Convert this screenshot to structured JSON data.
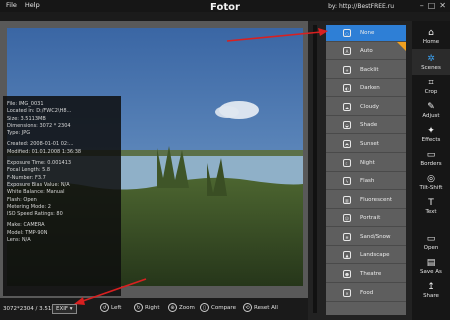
{
  "window": {
    "title": "Fotor",
    "menu": [
      "File",
      "Help"
    ],
    "watermark": "by: http://BestFREE.ru",
    "controls": [
      "–",
      "□",
      "✕"
    ]
  },
  "info": {
    "lines": [
      "File: IMG_0031",
      "Located in: D:/FWC2\\H8...",
      "Size: 3.5113MB",
      "Dimensions: 3072 * 2304",
      "Type: JPG",
      "",
      "Created: 2008-01-01 02:...",
      "Modified: 01.01.2008 1:36:38",
      "",
      "Exposure Time: 0.001413",
      "Focal Length: 5.8",
      "F-Number: F3.7",
      "Exposure Bias Value: N/A",
      "White Balance: Manual",
      "Flash: Open",
      "Metering Mode: 2",
      "ISO Speed Ratings: 80",
      "",
      "Make: CAMERA",
      "Model: TMP-90N",
      "Lens: N/A"
    ]
  },
  "bottom": {
    "dimensions": "3072*2304 / 3.51MB",
    "exif_label": "EXIF",
    "buttons": [
      "Left",
      "Right",
      "Zoom",
      "Compare",
      "Reset All"
    ]
  },
  "scenes": [
    "None",
    "Auto",
    "Backlit",
    "Darken",
    "Cloudy",
    "Shade",
    "Sunset",
    "Night",
    "Flash",
    "Fluorescent",
    "Portrait",
    "Sand/Snow",
    "Landscape",
    "Theatre",
    "Food"
  ],
  "tools": [
    {
      "label": "Scenes",
      "icon": "✲"
    },
    {
      "label": "Crop",
      "icon": "⌗"
    },
    {
      "label": "Adjust",
      "icon": "✎"
    },
    {
      "label": "Effects",
      "icon": "✦"
    },
    {
      "label": "Borders",
      "icon": "▭"
    },
    {
      "label": "Tilt-Shift",
      "icon": "◎"
    },
    {
      "label": "Text",
      "icon": "T"
    },
    {
      "label": "Open",
      "icon": "▭"
    },
    {
      "label": "Save As",
      "icon": "▤"
    },
    {
      "label": "Share",
      "icon": "↥"
    }
  ],
  "colors": {
    "selected_scene": "#2e7fd6",
    "active_tool_icon": "#3aa0f0",
    "badge": "#f0a020",
    "arrow": "#d82020"
  }
}
